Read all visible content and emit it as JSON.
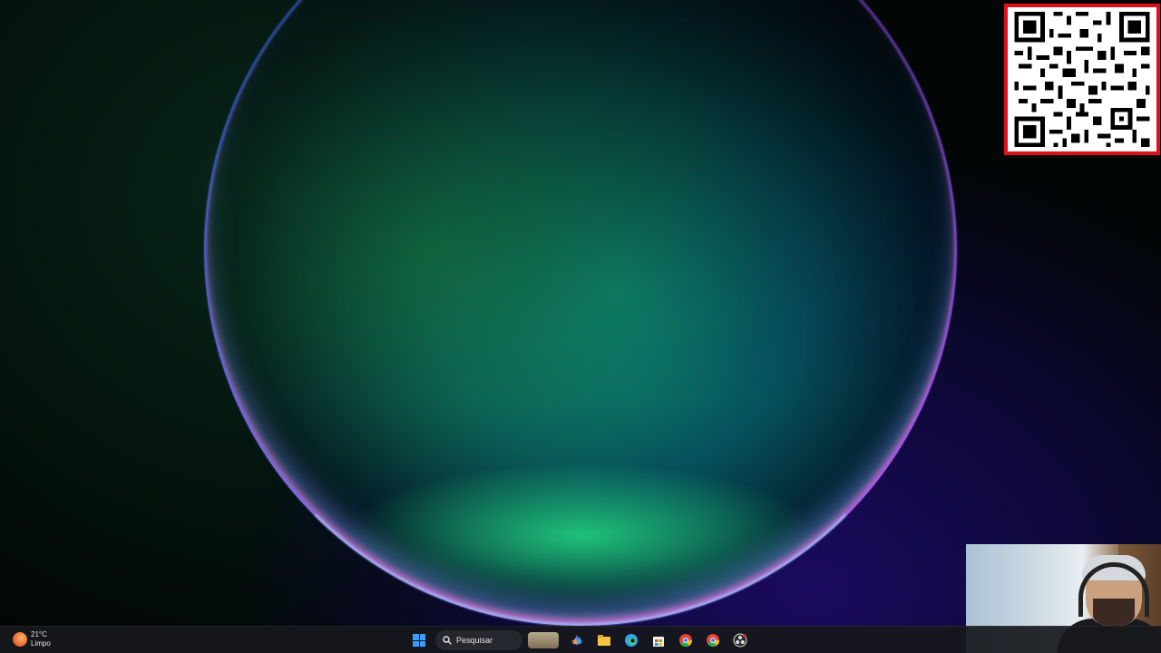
{
  "weather": {
    "temperature": "21°C",
    "condition": "Limpo",
    "icon": "weather-clear-night-icon"
  },
  "taskbar": {
    "search_label": "Pesquisar",
    "apps": [
      {
        "name": "copilot-icon",
        "color": "#7b6cff"
      },
      {
        "name": "file-explorer-icon",
        "color": "#f4c542"
      },
      {
        "name": "edge-icon",
        "color": "#2fa7e6"
      },
      {
        "name": "microsoft-store-icon",
        "color": "#2b83e8"
      },
      {
        "name": "chrome-icon",
        "color": "#34a853"
      },
      {
        "name": "chrome-icon",
        "color": "#34a853"
      },
      {
        "name": "obs-icon",
        "color": "#2b2b2b"
      }
    ]
  },
  "overlays": {
    "qr_border_color": "#e0101a"
  },
  "colors": {
    "start_accent": "#3aa0ff",
    "taskbar_bg": "#16181c"
  }
}
